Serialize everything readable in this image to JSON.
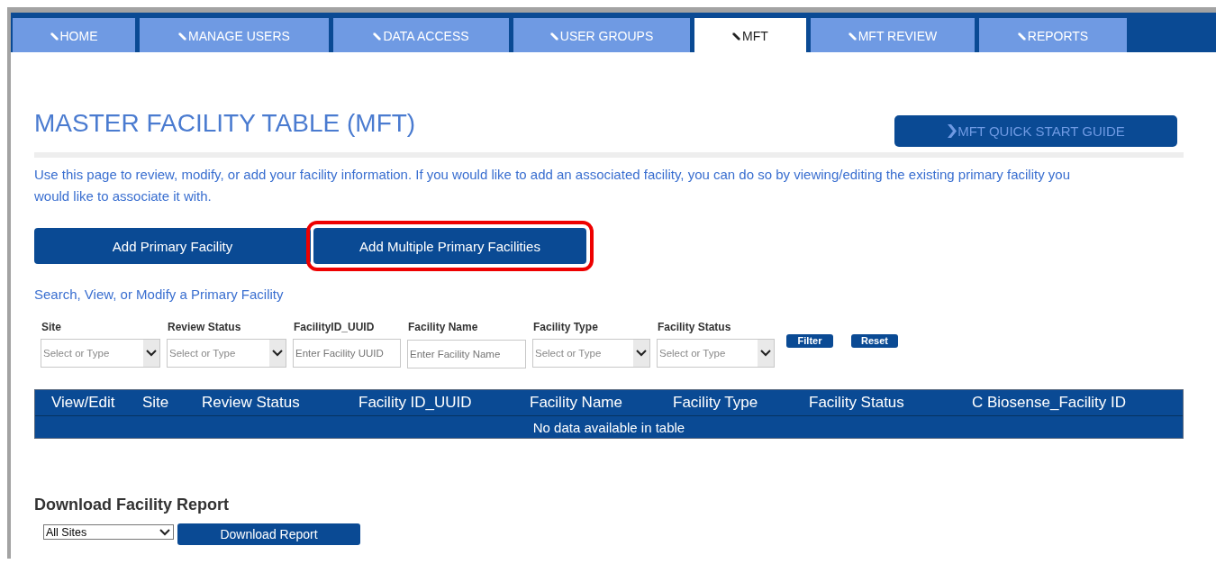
{
  "nav_tabs": [
    {
      "label": "HOME",
      "selected": false
    },
    {
      "label": "MANAGE USERS",
      "selected": false
    },
    {
      "label": "DATA ACCESS",
      "selected": false
    },
    {
      "label": "USER GROUPS",
      "selected": false
    },
    {
      "label": "MFT",
      "selected": true
    },
    {
      "label": "MFT REVIEW",
      "selected": false
    },
    {
      "label": "REPORTS",
      "selected": false
    }
  ],
  "page": {
    "title": "MASTER FACILITY TABLE (MFT)",
    "guide_button": "MFT QUICK START GUIDE",
    "intro": "Use this page to review, modify, or add your facility information. If you would like to add an associated facility, you can do so by viewing/editing the existing primary facility you would like to associate it with.",
    "actions": [
      {
        "label": "Add Primary Facility",
        "highlighted": false
      },
      {
        "label": "Add Multiple Primary Facilities",
        "highlighted": true
      }
    ],
    "search_heading": "Search, View, or Modify a Primary Facility"
  },
  "filters": [
    {
      "label": "Site",
      "kind": "select",
      "placeholder": "Select or Type"
    },
    {
      "label": "Review Status",
      "kind": "select",
      "placeholder": "Select or Type"
    },
    {
      "label": "FacilityID_UUID",
      "kind": "text",
      "placeholder": "Enter Facility UUID"
    },
    {
      "label": "Facility Name",
      "kind": "text",
      "placeholder": "Enter Facility Name"
    },
    {
      "label": "Facility Type",
      "kind": "select",
      "placeholder": "Select or Type"
    },
    {
      "label": "Facility Status",
      "kind": "select",
      "placeholder": "Select or Type"
    }
  ],
  "filter_buttons": [
    "Filter",
    "Reset"
  ],
  "table": {
    "columns": [
      "View/Edit",
      "Site",
      "Review Status",
      "Facility ID_UUID",
      "Facility Name",
      "Facility Type",
      "Facility Status",
      "C Biosense_Facility ID"
    ],
    "empty_message": "No data available in table"
  },
  "download": {
    "heading": "Download Facility Report",
    "site_select": "All Sites",
    "button": "Download Report"
  }
}
